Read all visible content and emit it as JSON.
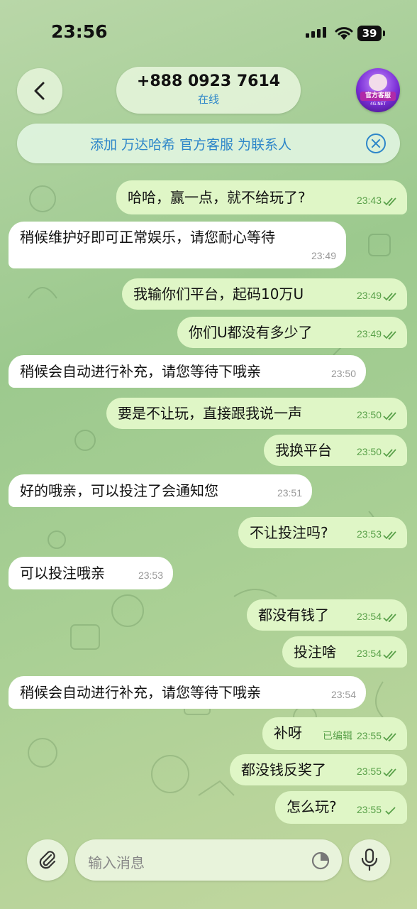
{
  "status": {
    "time": "23:56",
    "battery": "39"
  },
  "header": {
    "title": "+888 0923 7614",
    "subtitle": "在线",
    "avatar_tag": "官方客服",
    "avatar_site": "4G.NET"
  },
  "banner": {
    "text": "添加 万达哈希 官方客服 为联系人"
  },
  "messages": [
    {
      "dir": "out",
      "text": "哈哈，赢一点，就不给玩了?",
      "time": "23:43",
      "read": true
    },
    {
      "dir": "in",
      "text": "稍候维护好即可正常娱乐，请您耐心等待",
      "time": "23:49"
    },
    {
      "dir": "out",
      "text": "我输你们平台，起码10万U",
      "time": "23:49",
      "read": true
    },
    {
      "dir": "out",
      "text": "你们U都没有多少了",
      "time": "23:49",
      "read": true
    },
    {
      "dir": "in",
      "text": "稍候会自动进行补充，请您等待下哦亲",
      "time": "23:50"
    },
    {
      "dir": "out",
      "text": "要是不让玩，直接跟我说一声",
      "time": "23:50",
      "read": true
    },
    {
      "dir": "out",
      "text": "我换平台",
      "time": "23:50",
      "read": true
    },
    {
      "dir": "in",
      "text": "好的哦亲，可以投注了会通知您",
      "time": "23:51"
    },
    {
      "dir": "out",
      "text": "不让投注吗?",
      "time": "23:53",
      "read": true
    },
    {
      "dir": "in",
      "text": "可以投注哦亲",
      "time": "23:53"
    },
    {
      "dir": "out",
      "text": "都没有钱了",
      "time": "23:54",
      "read": true
    },
    {
      "dir": "out",
      "text": "投注啥",
      "time": "23:54",
      "read": true
    },
    {
      "dir": "in",
      "text": "稍候会自动进行补充，请您等待下哦亲",
      "time": "23:54"
    },
    {
      "dir": "out",
      "text": "补呀",
      "time": "23:55",
      "edited": "已编辑",
      "read": true
    },
    {
      "dir": "out",
      "text": "都没钱反奖了",
      "time": "23:55",
      "read": true
    },
    {
      "dir": "out",
      "text": "怎么玩?",
      "time": "23:55",
      "read": false
    }
  ],
  "composer": {
    "placeholder": "输入消息"
  },
  "colors": {
    "accent": "#2d86c9",
    "outgoing": "#dff6c6",
    "check": "#5aa14a"
  },
  "icons": [
    "back-icon",
    "signal-icon",
    "wifi-icon",
    "close-icon",
    "attach-icon",
    "sticker-icon",
    "mic-icon",
    "double-check-icon",
    "single-check-icon"
  ]
}
